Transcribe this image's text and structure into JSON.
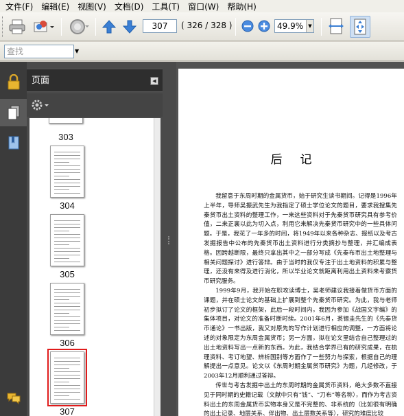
{
  "menu": [
    "文件(F)",
    "编辑(E)",
    "视图(V)",
    "文档(D)",
    "工具(T)",
    "窗口(W)",
    "帮助(H)"
  ],
  "toolbar": {
    "page_value": "307",
    "page_count": "( 326 / 328 )",
    "zoom_value": "49.9%"
  },
  "find": {
    "placeholder": "查找"
  },
  "panel": {
    "title": "页面",
    "thumbnails": [
      {
        "label": "303"
      },
      {
        "label": "304"
      },
      {
        "label": "305"
      },
      {
        "label": "306"
      },
      {
        "label": "307",
        "selected": true
      }
    ]
  },
  "document": {
    "title": "后记",
    "paragraphs": [
      "我留意于东周时期的金属货币，始于研究生读书期间。记得是1996年上半年，导师吴振武先生为我指定了硕士学位论文的题目，要求我搜集先秦货币出土资料的整理工作，一来这些资料对于先秦货币研究具有参考价值，二来正襄以此为切入点，利用它来解决先秦货币研究中的一些具体问题。于是，我花了一年多的时间，将1949年以来各种杂志、报纸以及考古发掘报告中公布的先秦货币出土资料进行分类摘抄与整理，并汇编成表格。因跨越断限，最终只拿出其中之一部分写成《先秦布币出土地整理与相关问题探讨》进行答辩。由于当时的我仅专注于出土地资料的积累与整理，还没有来得及进行消化，所以毕业论文就距离利用出土资料来考察货币研究服务。",
      "1999年9月，我开始在职攻读博士，吴老师建议我接着做货币方面的课题，并在硕士论文的基础上扩展到整个先秦货币研究。为此，我与老师初步拟订了论文的框架，此后一段时间内，我因为参加《战国文字编》的集体项目，对论文的准备时断时续。2001年6月，裘锡圭先生的《先秦货币通论》一书出版，我又对原先的写作计划进行相应的调整，一方面将论述的对象限定为东周金属货币；另一方面，拟在论文里结合自己整理过的出土地资料写出一点新的东西。为此，我结合学界已有的研究成果，在梳理资料、考订地望、辨析国别等方面作了一些努力与探索，根据自己的理解提出一点意见。论文以《东周时期金属货币研究》为题，几经修改，于2003年12月顺利通过答辩。",
      "传世与考古发掘中出土的东周时期的金属货币资料，绝大多数不直接见于同时期的史籍记载（文献中只有“钱”、“刀布”等名称），而作为考古资料出土的东周金属货币实物本身又是不完整的、非系统的（比如很有明确的出土记录、地层关系、伴出物、出土层数关系等），研究的难度比较"
    ]
  },
  "colors": {
    "menubar_bg": "#f0efe9",
    "panel_bg": "#4a4a4a",
    "doc_bg": "#525252",
    "selection": "#e01b1b"
  },
  "icons": [
    "print-icon",
    "email-icon",
    "sync-icon",
    "arrow-up-icon",
    "arrow-down-icon",
    "zoom-out-icon",
    "zoom-in-icon",
    "fit-width-icon",
    "fit-page-icon",
    "lock-icon",
    "pages-icon",
    "bookmarks-icon",
    "comment-icon",
    "gear-icon"
  ]
}
